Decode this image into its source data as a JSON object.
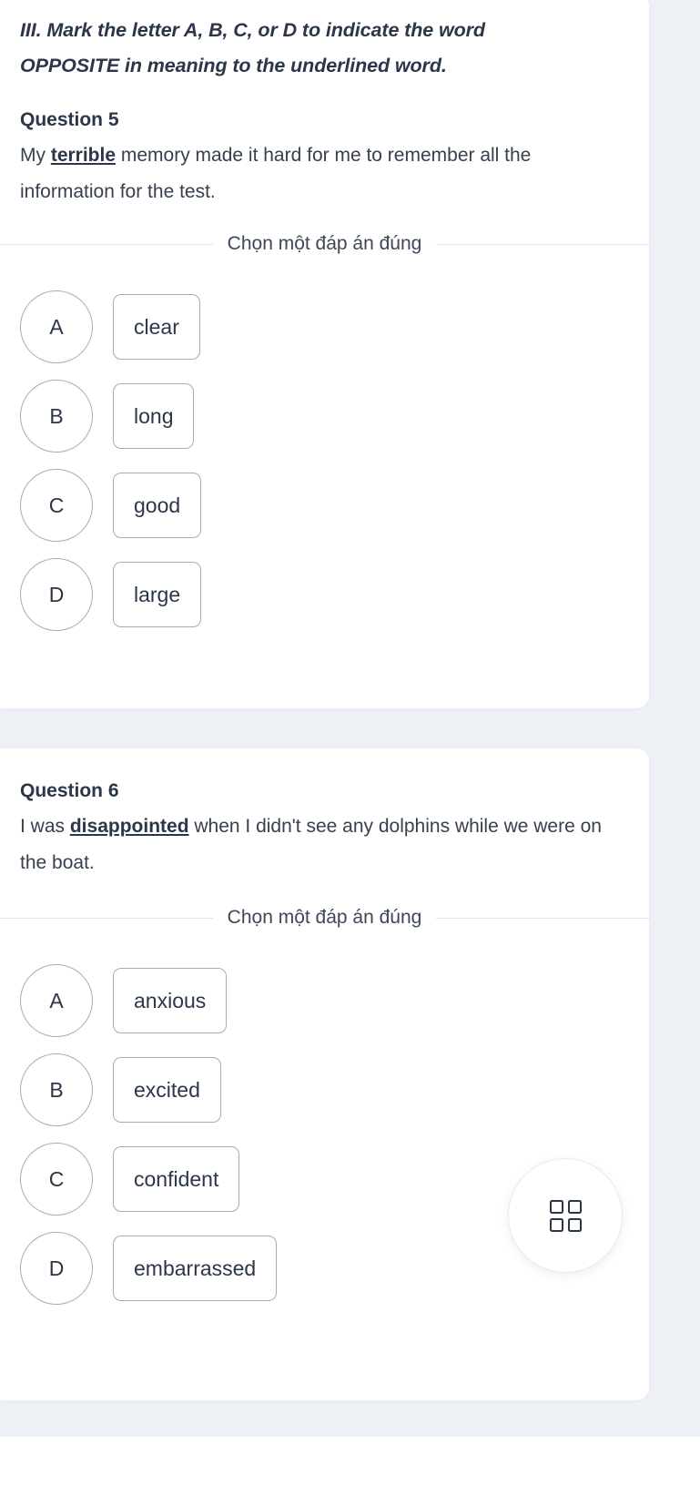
{
  "section": {
    "heading_line1": "III. Mark the letter A, B, C, or D to indicate the word",
    "heading_line2": "OPPOSITE in meaning to the underlined word."
  },
  "choose_prompt": "Chọn một đáp án đúng",
  "questions": [
    {
      "label": "Question 5",
      "text_before": "My ",
      "underlined": "terrible",
      "text_after": " memory made it hard for me to remember all the information for the test.",
      "options": [
        {
          "letter": "A",
          "text": "clear"
        },
        {
          "letter": "B",
          "text": "long"
        },
        {
          "letter": "C",
          "text": "good"
        },
        {
          "letter": "D",
          "text": "large"
        }
      ]
    },
    {
      "label": "Question 6",
      "text_before": "I was ",
      "underlined": "disappointed",
      "text_after": " when I didn't see any dolphins while we were on the boat.",
      "options": [
        {
          "letter": "A",
          "text": "anxious"
        },
        {
          "letter": "B",
          "text": "excited"
        },
        {
          "letter": "C",
          "text": "confident"
        },
        {
          "letter": "D",
          "text": "embarrassed"
        }
      ]
    }
  ],
  "fab": {
    "icon": "grid-icon"
  },
  "colors": {
    "page_background": "#edf0f5",
    "card_background": "#ffffff",
    "text_primary": "#2b3648",
    "text_body": "#36404f",
    "border_muted": "#9fadc2",
    "divider": "#dfe5ee"
  }
}
